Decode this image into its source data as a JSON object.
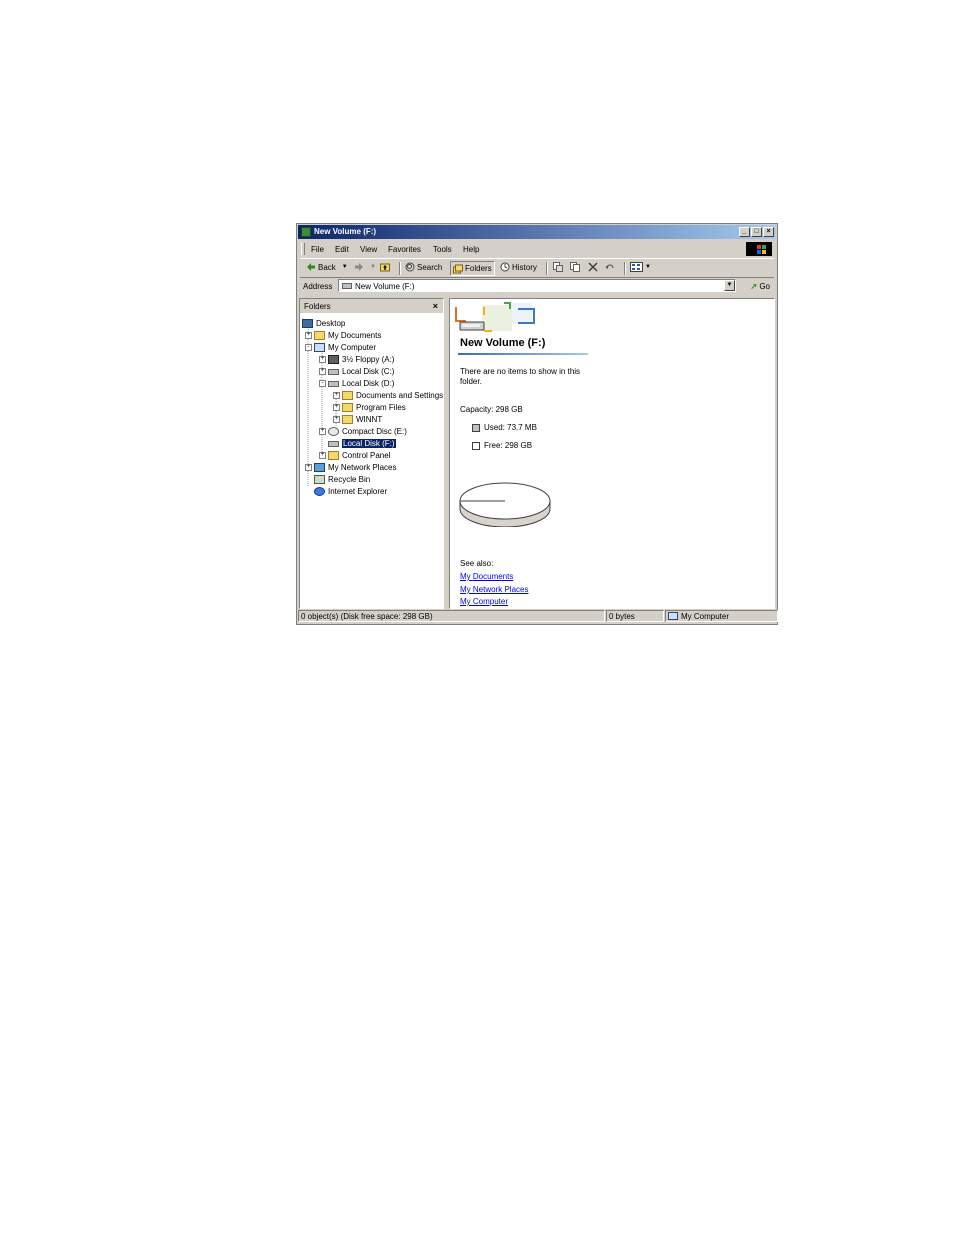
{
  "window": {
    "title": "New Volume (F:)",
    "controls": [
      "_",
      "□",
      "×"
    ]
  },
  "menu": [
    "File",
    "Edit",
    "View",
    "Favorites",
    "Tools",
    "Help"
  ],
  "toolbar": {
    "back": "Back",
    "search": "Search",
    "folders": "Folders",
    "history": "History"
  },
  "address": {
    "label": "Address",
    "value": "New Volume (F:)",
    "go": "Go"
  },
  "folders_panel": {
    "title": "Folders",
    "close": "×",
    "tree": [
      {
        "label": "Desktop",
        "depth": 0,
        "expander": "",
        "icon": "desktop-icon"
      },
      {
        "label": "My Documents",
        "depth": 1,
        "expander": "+",
        "icon": "folder-icon"
      },
      {
        "label": "My Computer",
        "depth": 1,
        "expander": "-",
        "icon": "computer-icon"
      },
      {
        "label": "3½ Floppy (A:)",
        "depth": 2,
        "expander": "+",
        "icon": "floppy-icon"
      },
      {
        "label": "Local Disk (C:)",
        "depth": 2,
        "expander": "+",
        "icon": "drive-icon"
      },
      {
        "label": "Local Disk (D:)",
        "depth": 2,
        "expander": "-",
        "icon": "drive-icon"
      },
      {
        "label": "Documents and Settings",
        "depth": 3,
        "expander": "+",
        "icon": "folder-icon"
      },
      {
        "label": "Program Files",
        "depth": 3,
        "expander": "+",
        "icon": "folder-icon"
      },
      {
        "label": "WINNT",
        "depth": 3,
        "expander": "+",
        "icon": "folder-icon"
      },
      {
        "label": "Compact Disc (E:)",
        "depth": 2,
        "expander": "+",
        "icon": "cd-icon"
      },
      {
        "label": "Local Disk (F:)",
        "depth": 2,
        "expander": "",
        "icon": "drive-icon",
        "selected": true
      },
      {
        "label": "Control Panel",
        "depth": 2,
        "expander": "+",
        "icon": "control-panel-icon"
      },
      {
        "label": "My Network Places",
        "depth": 1,
        "expander": "+",
        "icon": "network-icon"
      },
      {
        "label": "Recycle Bin",
        "depth": 1,
        "expander": "",
        "icon": "recycle-bin-icon"
      },
      {
        "label": "Internet Explorer",
        "depth": 1,
        "expander": "",
        "icon": "ie-icon"
      }
    ]
  },
  "content": {
    "volume_title": "New Volume (F:)",
    "empty_message": "There are no items to show in this folder.",
    "capacity": "Capacity: 298 GB",
    "used": "Used: 73.7 MB",
    "free": "Free: 298 GB",
    "see_also": "See also:",
    "links": [
      "My Documents",
      "My Network Places",
      "My Computer"
    ],
    "used_fraction": 0.0002
  },
  "status": {
    "objects": "0 object(s) (Disk free space: 298 GB)",
    "size": "0 bytes",
    "zone": "My Computer"
  },
  "colors": {
    "title_start": "#0a246a",
    "title_end": "#a6caf0",
    "selection": "#0a246a",
    "link": "#0000ff",
    "face": "#d4d0c8"
  }
}
